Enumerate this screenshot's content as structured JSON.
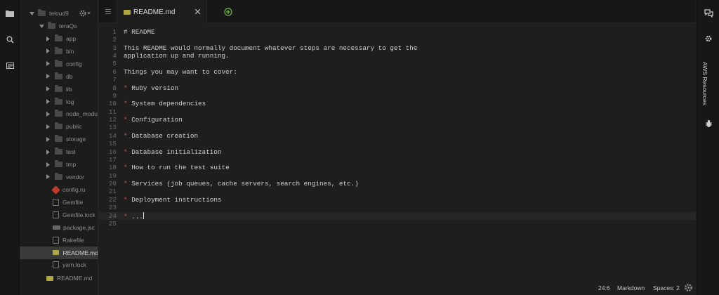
{
  "tree": {
    "root": "teloud9",
    "project": "teraQs",
    "folders": [
      "app",
      "bin",
      "config",
      "db",
      "lib",
      "log",
      "node_modu",
      "public",
      "storage",
      "test",
      "tmp",
      "vendor"
    ],
    "files": [
      {
        "name": "config.ru",
        "icon": "ruby-file-icon"
      },
      {
        "name": "Gemfile",
        "icon": "file-icon"
      },
      {
        "name": "Gemfile.lock",
        "icon": "file-icon"
      },
      {
        "name": "package.jsc",
        "icon": "json-file-icon"
      },
      {
        "name": "Rakefile",
        "icon": "file-icon"
      },
      {
        "name": "README.md",
        "icon": "markdown-file-icon",
        "selected": true
      },
      {
        "name": "yarn.lock",
        "icon": "file-icon"
      }
    ],
    "root_files": [
      {
        "name": "README.md",
        "icon": "markdown-file-icon"
      }
    ]
  },
  "tab": {
    "title": "README.md"
  },
  "editor": {
    "lines": [
      {
        "n": "1",
        "text": "# README"
      },
      {
        "n": "2",
        "text": ""
      },
      {
        "n": "3",
        "text": "This README would normally document whatever steps are necessary to get the"
      },
      {
        "n": "4",
        "text": "application up and running."
      },
      {
        "n": "5",
        "text": ""
      },
      {
        "n": "6",
        "text": "Things you may want to cover:"
      },
      {
        "n": "7",
        "text": ""
      },
      {
        "n": "8",
        "text": "Ruby version",
        "bullet": true
      },
      {
        "n": "9",
        "text": ""
      },
      {
        "n": "10",
        "text": "System dependencies",
        "bullet": true
      },
      {
        "n": "11",
        "text": ""
      },
      {
        "n": "12",
        "text": "Configuration",
        "bullet": true
      },
      {
        "n": "13",
        "text": ""
      },
      {
        "n": "14",
        "text": "Database creation",
        "bullet": true
      },
      {
        "n": "15",
        "text": ""
      },
      {
        "n": "16",
        "text": "Database initialization",
        "bullet": true
      },
      {
        "n": "17",
        "text": ""
      },
      {
        "n": "18",
        "text": "How to run the test suite",
        "bullet": true
      },
      {
        "n": "19",
        "text": ""
      },
      {
        "n": "20",
        "text": "Services (job queues, cache servers, search engines, etc.)",
        "bullet": true
      },
      {
        "n": "21",
        "text": ""
      },
      {
        "n": "22",
        "text": "Deployment instructions",
        "bullet": true
      },
      {
        "n": "23",
        "text": ""
      },
      {
        "n": "24",
        "text": "...",
        "bullet": true,
        "active": true
      },
      {
        "n": "25",
        "text": ""
      }
    ],
    "bullet_char": "*"
  },
  "status": {
    "position": "24:6",
    "mode": "Markdown",
    "spaces": "Spaces: 2"
  },
  "right_panel": {
    "aws_label": "AWS Resources"
  }
}
